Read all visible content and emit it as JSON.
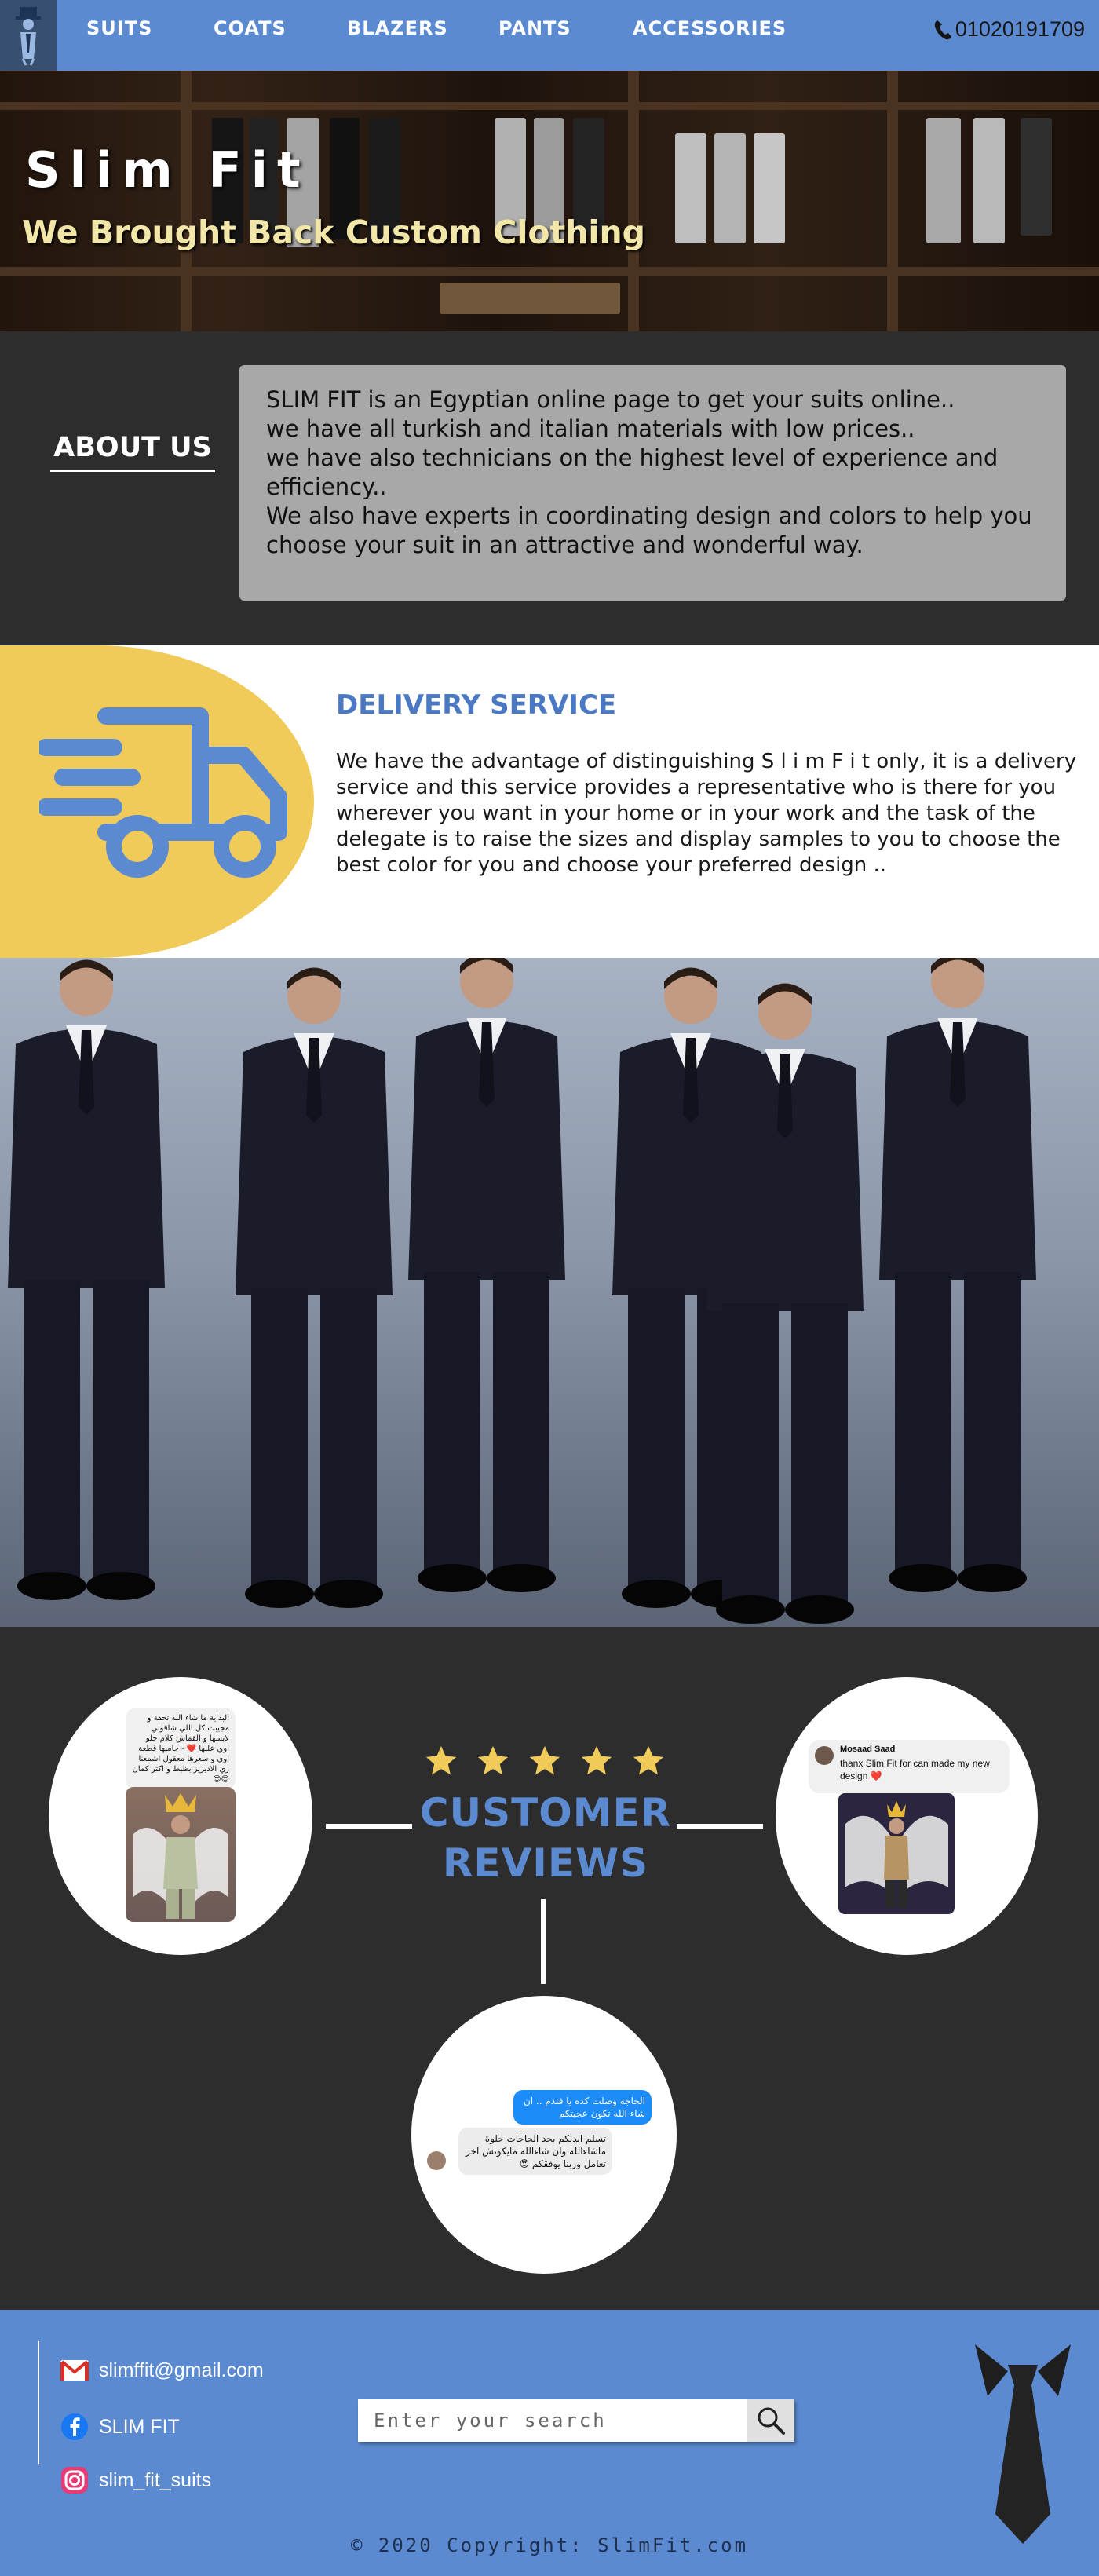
{
  "nav": {
    "items": [
      "SUITS",
      "COATS",
      "BLAZERS",
      "PANTS",
      "ACCESSORIES"
    ],
    "phone": "01020191709"
  },
  "hero": {
    "title": "Slim Fit",
    "subtitle": "We Brought Back Custom Clothing"
  },
  "about": {
    "title": "ABOUT US",
    "lines": [
      "SLIM FIT is an Egyptian online page to get your suits online..",
      "we have all turkish and italian materials with low prices..",
      "we have also technicians on the highest level of experience and efficiency..",
      "We also have experts in coordinating design and colors to help you choose your suit in an attractive and wonderful way."
    ]
  },
  "delivery": {
    "title": "DELIVERY SERVICE",
    "text": "We have the advantage of distinguishing S l i m F i t only, it is a delivery service and this service provides a representative who is there for you wherever you want in your home or in your work and the task of the delegate is to raise the sizes and display samples to you to choose the best color for you and choose your preferred design .."
  },
  "reviews": {
    "title_line1": "CUSTOMER",
    "title_line2": "REVIEWS",
    "rating": 5,
    "review1_text": "البداية ما شاء الله تحفة و مجيبت كل اللي شافوني لابسها و القماش كلام حلو اوي عليها ❤️ - جاميها قطعة اوي و سعرها معقول اشمعنا زي الاديزيز بظبط و اكثر كمان 😍😍",
    "review2_name": "Mosaad Saad",
    "review2_text": "thanx Slim Fit for can made my new design ❤️",
    "review3_sent": "الحاجه وصلت كده يا فندم .. ان شاء الله تكون عجبتكم",
    "review3_reply": "تسلم ايديكم بجد الحاجات حلوة ماشاءالله وان شاءالله مايكونش اخر تعامل وربنا يوفقكم 😍"
  },
  "footer": {
    "email": "slimffit@gmail.com",
    "facebook": "SLIM FIT",
    "instagram": "slim_fit_suits",
    "search_placeholder": "Enter your search",
    "copyright": "© 2020 Copyright: SlimFit.com"
  },
  "colors": {
    "primary": "#5b8ad1",
    "dark": "#2d2d2d",
    "accent_yellow": "#f1cb5a",
    "subtitle_yellow": "#f2e7a8"
  },
  "icons": [
    "logo-icon",
    "phone-icon",
    "truck-icon",
    "star-icon",
    "gmail-icon",
    "facebook-icon",
    "instagram-icon",
    "search-icon",
    "tie-icon"
  ]
}
